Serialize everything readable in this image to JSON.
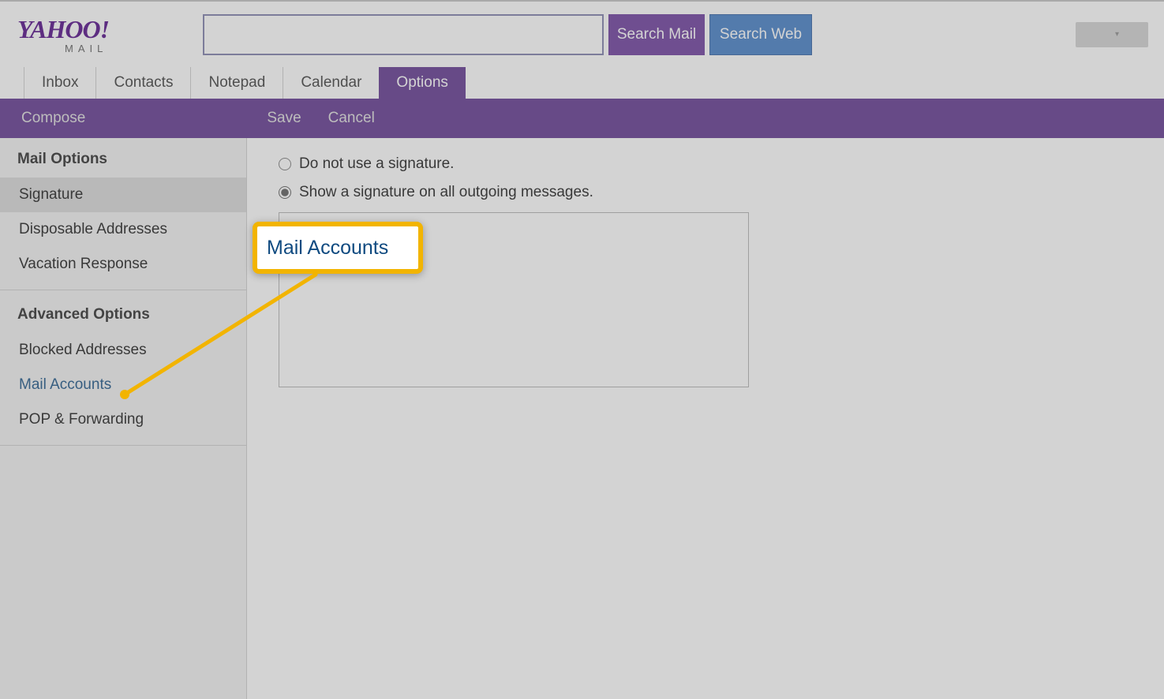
{
  "logo": {
    "main": "YAHOO",
    "exclaim": "!",
    "sub": "MAIL"
  },
  "search": {
    "search_mail_label": "Search Mail",
    "search_web_label": "Search Web"
  },
  "tabs": {
    "inbox": "Inbox",
    "contacts": "Contacts",
    "notepad": "Notepad",
    "calendar": "Calendar",
    "options": "Options"
  },
  "actionbar": {
    "compose": "Compose",
    "save": "Save",
    "cancel": "Cancel"
  },
  "sidebar": {
    "mail_options_header": "Mail Options",
    "signature": "Signature",
    "disposable": "Disposable Addresses",
    "vacation": "Vacation Response",
    "advanced_header": "Advanced Options",
    "blocked": "Blocked Addresses",
    "mail_accounts": "Mail Accounts",
    "pop_forwarding": "POP & Forwarding"
  },
  "main": {
    "radio_no_sig": "Do not use a signature.",
    "radio_show_sig": "Show a signature on all outgoing messages."
  },
  "callout": {
    "label": "Mail Accounts"
  },
  "colors": {
    "purple": "#5a2d8a",
    "blue": "#3b78c4",
    "highlight": "#f2b400",
    "link": "#0f4a80"
  }
}
